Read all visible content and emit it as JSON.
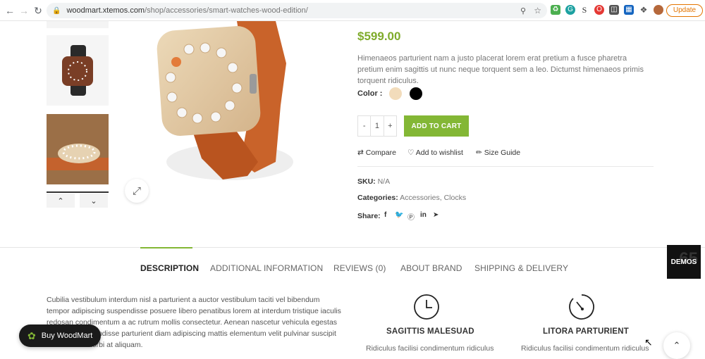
{
  "browser": {
    "url_host": "woodmart.xtemos.com",
    "url_path": "/shop/accessories/smart-watches-wood-edition/",
    "update_label": "Update"
  },
  "product": {
    "price": "$599.00",
    "description": "Himenaeos parturient nam a justo placerat lorem erat pretium a fusce pharetra pretium enim sagittis ut nunc neque torquent sem a leo. Dictumst himenaeos primis torquent ridiculus.",
    "color_label": "Color :",
    "colors": [
      "#f2dcbb",
      "#000000"
    ],
    "quantity": "1",
    "qty_minus": "-",
    "qty_plus": "+",
    "add_to_cart": "ADD TO CART",
    "compare": "Compare",
    "wishlist": "Add to wishlist",
    "size_guide": "Size Guide",
    "sku_label": "SKU:",
    "sku_value": "N/A",
    "categories_label": "Categories:",
    "category_1": "Accessories",
    "category_sep": ",",
    "category_2": "Clocks",
    "share_label": "Share:"
  },
  "tabs": [
    {
      "label": "DESCRIPTION"
    },
    {
      "label": "ADDITIONAL INFORMATION"
    },
    {
      "label": "REVIEWS (0)"
    },
    {
      "label": "ABOUT BRAND"
    },
    {
      "label": "SHIPPING & DELIVERY"
    }
  ],
  "demos_label": "DEMOS",
  "demos_bg_number": "65",
  "description_text": "Cubilia vestibulum interdum nisl a parturient a auctor vestibulum taciti vel bibendum tempor adipiscing suspendisse posuere libero penatibus lorem at interdum tristique iaculis redosan condimentum a ac rutrum mollis consectetur. Aenean nascetur vehicula egestas a adipiscing a ondisse parturient diam adipiscing mattis elementum velit pulvinar suscipit acilisi tortor morbi at aliquam.",
  "features": [
    {
      "title": "SAGITTIS MALESUAD",
      "desc": "Ridiculus facilisi condimentum ridiculus"
    },
    {
      "title": "LITORA PARTURIENT",
      "desc": "Ridiculus facilisi condimentum ridiculus"
    }
  ],
  "buy_button": "Buy WoodMart",
  "accent_color": "#83b735"
}
